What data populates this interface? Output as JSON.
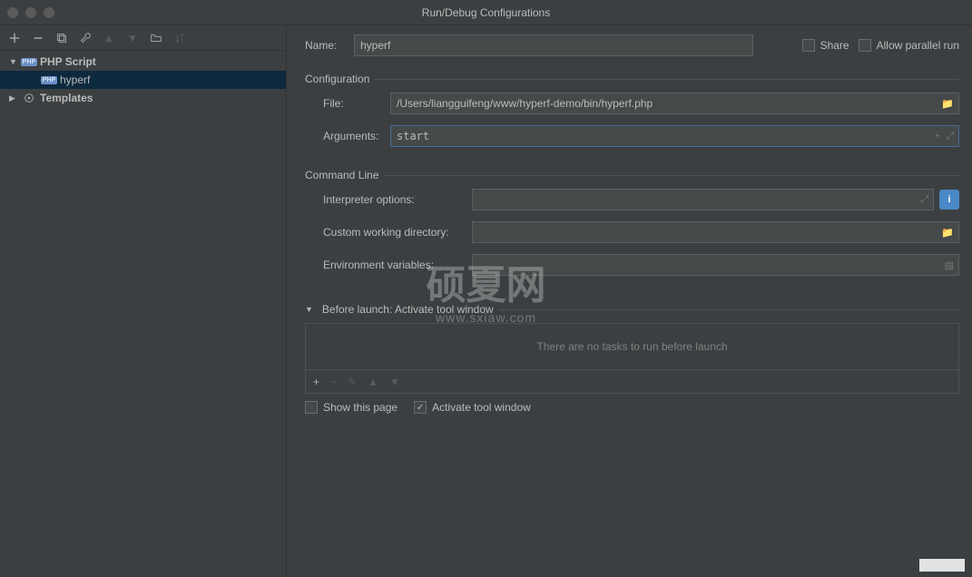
{
  "window": {
    "title": "Run/Debug Configurations"
  },
  "tree": {
    "php_script_label": "PHP Script",
    "hyperf_label": "hyperf",
    "templates_label": "Templates"
  },
  "form": {
    "name_label": "Name:",
    "name_value": "hyperf",
    "share_label": "Share",
    "allow_parallel_label": "Allow parallel run",
    "configuration_title": "Configuration",
    "file_label": "File:",
    "file_value": "/Users/liangguifeng/www/hyperf-demo/bin/hyperf.php",
    "arguments_label": "Arguments:",
    "arguments_value": "start",
    "command_line_title": "Command Line",
    "interpreter_options_label": "Interpreter options:",
    "interpreter_options_value": "",
    "custom_dir_label": "Custom working directory:",
    "custom_dir_value": "",
    "env_vars_label": "Environment variables:",
    "env_vars_value": "",
    "before_launch_title": "Before launch: Activate tool window",
    "no_tasks_msg": "There are no tasks to run before launch",
    "show_page_label": "Show this page",
    "activate_tool_label": "Activate tool window"
  },
  "watermark": {
    "big": "硕夏网",
    "small": "www.sxiaw.com"
  }
}
